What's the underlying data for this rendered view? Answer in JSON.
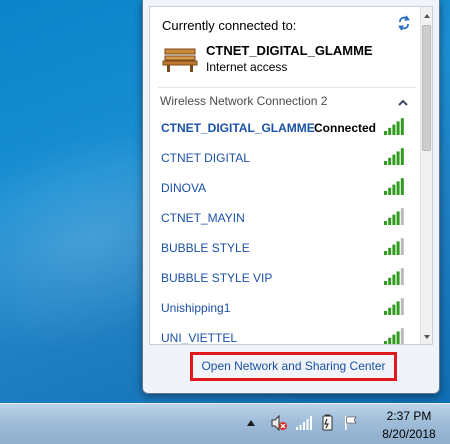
{
  "flyout": {
    "connected_heading": "Currently connected to:",
    "current": {
      "name": "CTNET_DIGITAL_GLAMME",
      "status": "Internet access",
      "icon": "bench-icon"
    },
    "group_header": "Wireless Network Connection 2",
    "networks": [
      {
        "name": "CTNET_DIGITAL_GLAMME",
        "state": "Connected",
        "signal_bars": 5
      },
      {
        "name": "CTNET DIGITAL",
        "state": "",
        "signal_bars": 5
      },
      {
        "name": "DINOVA",
        "state": "",
        "signal_bars": 5
      },
      {
        "name": "CTNET_MAYIN",
        "state": "",
        "signal_bars": 4
      },
      {
        "name": "BUBBLE STYLE",
        "state": "",
        "signal_bars": 4
      },
      {
        "name": "BUBBLE STYLE VIP",
        "state": "",
        "signal_bars": 4
      },
      {
        "name": "Unishipping1",
        "state": "",
        "signal_bars": 4
      },
      {
        "name": "UNI_VIETTEL",
        "state": "",
        "signal_bars": 4
      }
    ],
    "open_center_link": "Open Network and Sharing Center"
  },
  "taskbar": {
    "time": "2:37 PM",
    "date": "8/20/2018"
  },
  "colors": {
    "link_blue": "#1b51a6",
    "signal_green": "#2f9b1f",
    "highlight_red": "#e0181e"
  }
}
